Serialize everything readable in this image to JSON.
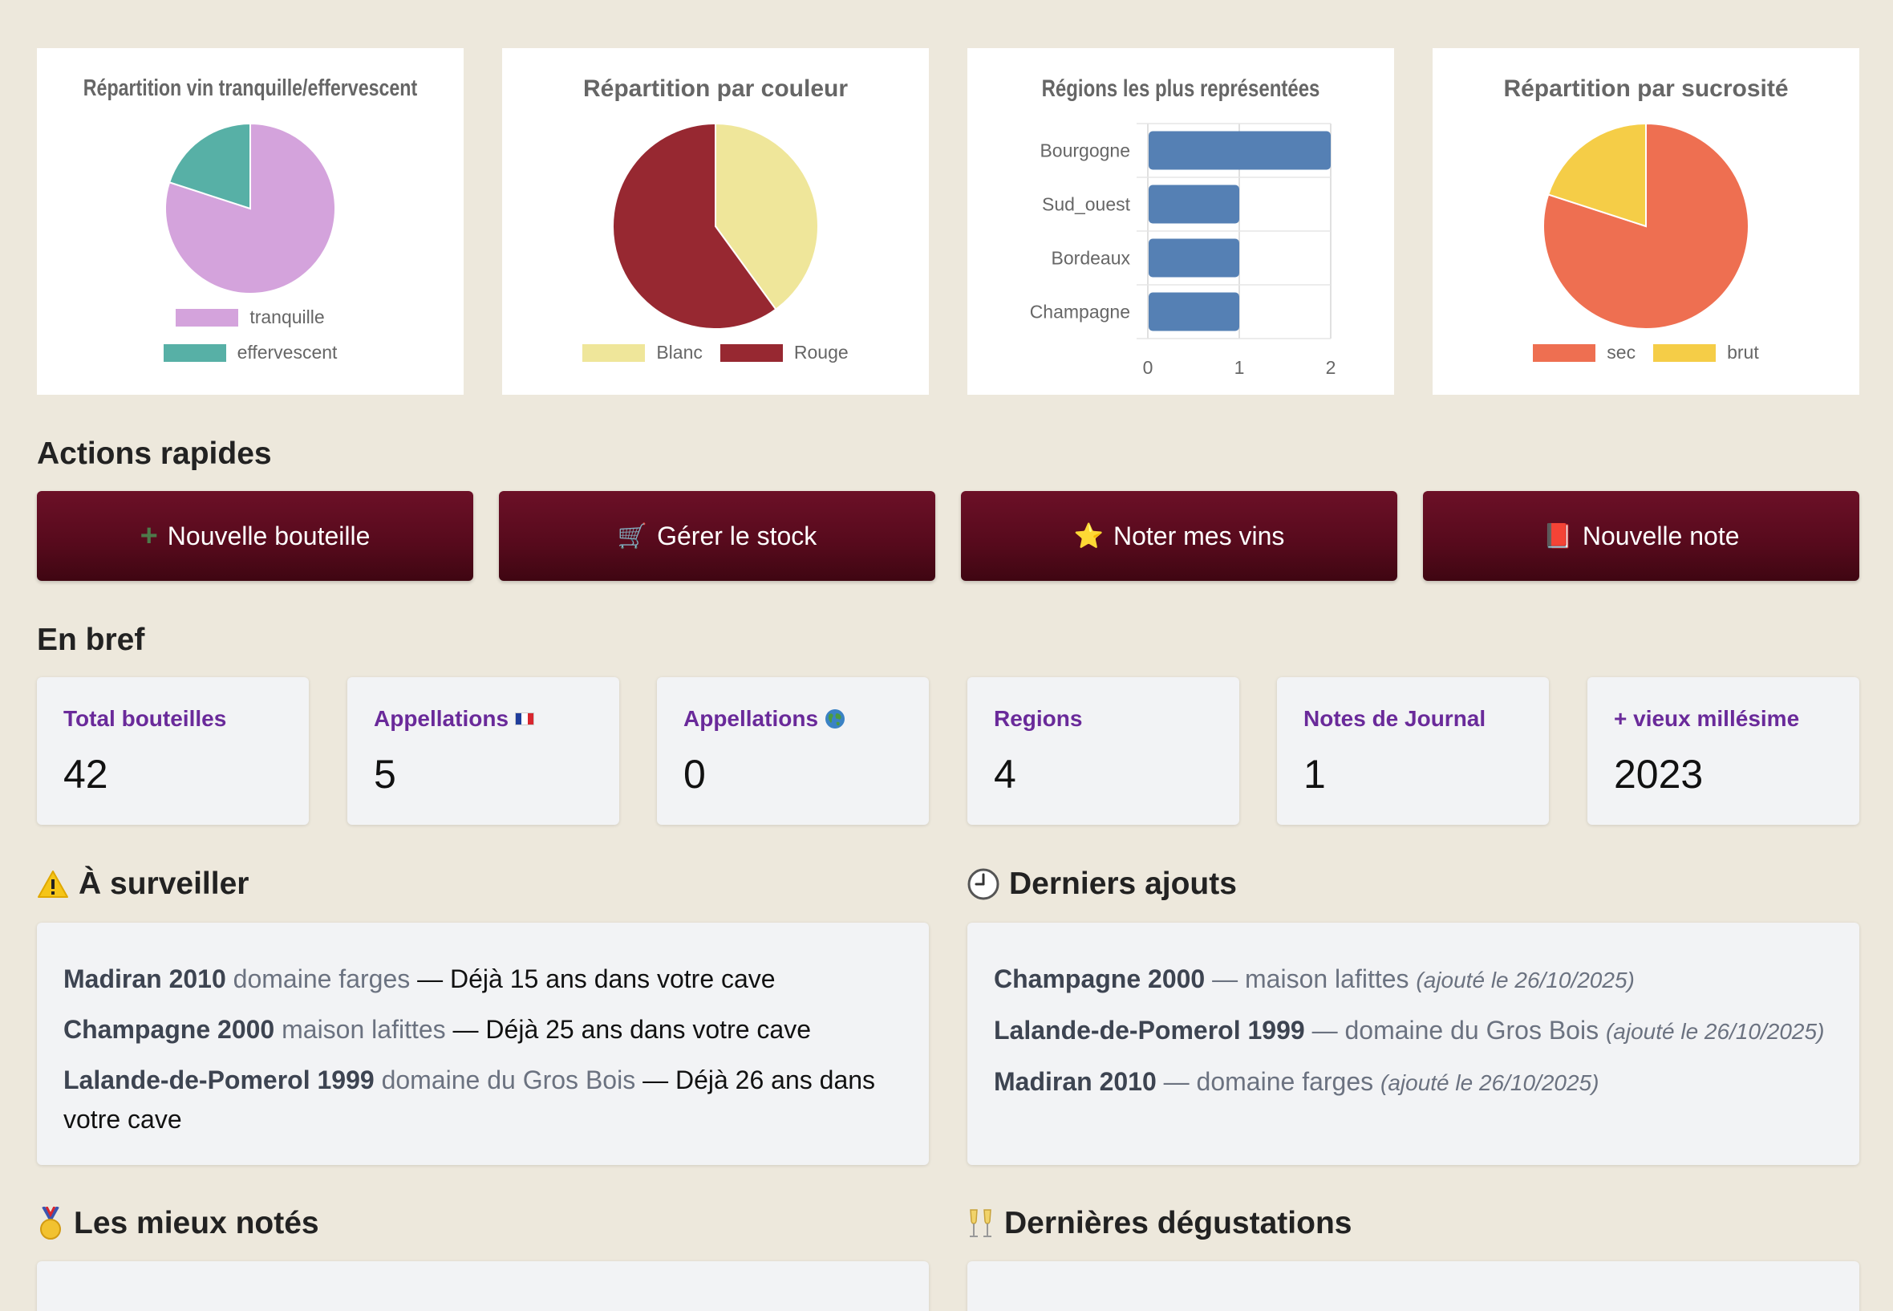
{
  "charts": [
    {
      "title": "Répartition vin tranquille/effervescent",
      "chart_data": {
        "type": "pie",
        "title": "Répartition vin tranquille/effervescent",
        "labels": [
          "tranquille",
          "effervescent"
        ],
        "values": [
          4,
          1
        ],
        "colors": [
          "#d4a3dc",
          "#57b0a6"
        ],
        "legend": "bottom"
      }
    },
    {
      "title": "Répartition par couleur",
      "chart_data": {
        "type": "pie",
        "title": "Répartition par couleur",
        "labels": [
          "Blanc",
          "Rouge"
        ],
        "values": [
          2,
          3
        ],
        "colors": [
          "#efe69a",
          "#972831"
        ],
        "legend": "bottom"
      }
    },
    {
      "title": "Régions les plus représentées",
      "chart_data": {
        "type": "bar",
        "orientation": "horizontal",
        "title": "Régions les plus représentées",
        "categories": [
          "Bourgogne",
          "Sud_ouest",
          "Bordeaux",
          "Champagne"
        ],
        "values": [
          2,
          1,
          1,
          1
        ],
        "xlim": [
          0,
          2
        ],
        "xticks": [
          "0",
          "1",
          "2"
        ],
        "color": "#5580b4",
        "grid": true
      }
    },
    {
      "title": "Répartition par sucrosité",
      "chart_data": {
        "type": "pie",
        "title": "Répartition par sucrosité",
        "labels": [
          "sec",
          "brut"
        ],
        "values": [
          4,
          1
        ],
        "colors": [
          "#ee6f51",
          "#f5cd47"
        ],
        "legend": "bottom"
      }
    }
  ],
  "quick_actions": {
    "title": "Actions rapides",
    "buttons": [
      {
        "icon": "+",
        "label": "Nouvelle bouteille"
      },
      {
        "icon": "🛒",
        "label": "Gérer le stock"
      },
      {
        "icon": "⭐",
        "label": "Noter mes vins"
      },
      {
        "icon": "📕",
        "label": "Nouvelle note"
      }
    ]
  },
  "summary": {
    "title": "En bref",
    "stats": [
      {
        "label": "Total bouteilles",
        "value": "42"
      },
      {
        "label": "Appellations",
        "value": "5"
      },
      {
        "label": "Appellations",
        "value": "0"
      },
      {
        "label": "Regions",
        "value": "4"
      },
      {
        "label": "Notes de Journal",
        "value": "1"
      },
      {
        "label": "+ vieux millésime",
        "value": "2023"
      }
    ]
  },
  "watch": {
    "title": "À surveiller",
    "items": [
      {
        "wine": "Madiran 2010",
        "producer": "domaine farges",
        "note": "— Déjà 15 ans dans votre cave"
      },
      {
        "wine": "Champagne 2000",
        "producer": "maison lafittes",
        "note": "— Déjà 25 ans dans votre cave"
      },
      {
        "wine": "Lalande-de-Pomerol 1999",
        "producer": "domaine du Gros Bois",
        "note": "— Déjà 26 ans dans votre cave"
      }
    ]
  },
  "recent": {
    "title": "Derniers ajouts",
    "items": [
      {
        "wine": "Champagne 2000",
        "producer": "— maison lafittes",
        "added": "(ajouté le 26/10/2025)"
      },
      {
        "wine": "Lalande-de-Pomerol 1999",
        "producer": "— domaine du Gros Bois",
        "added": "(ajouté le 26/10/2025)"
      },
      {
        "wine": "Madiran 2010",
        "producer": "— domaine farges",
        "added": "(ajouté le 26/10/2025)"
      }
    ]
  },
  "top_rated": {
    "title": "Les mieux notés"
  },
  "tastings": {
    "title": "Dernières dégustations"
  },
  "colors": {
    "accent": "#5a0c1f",
    "stat_label": "#6a2a9a",
    "background": "#ede8dc"
  }
}
